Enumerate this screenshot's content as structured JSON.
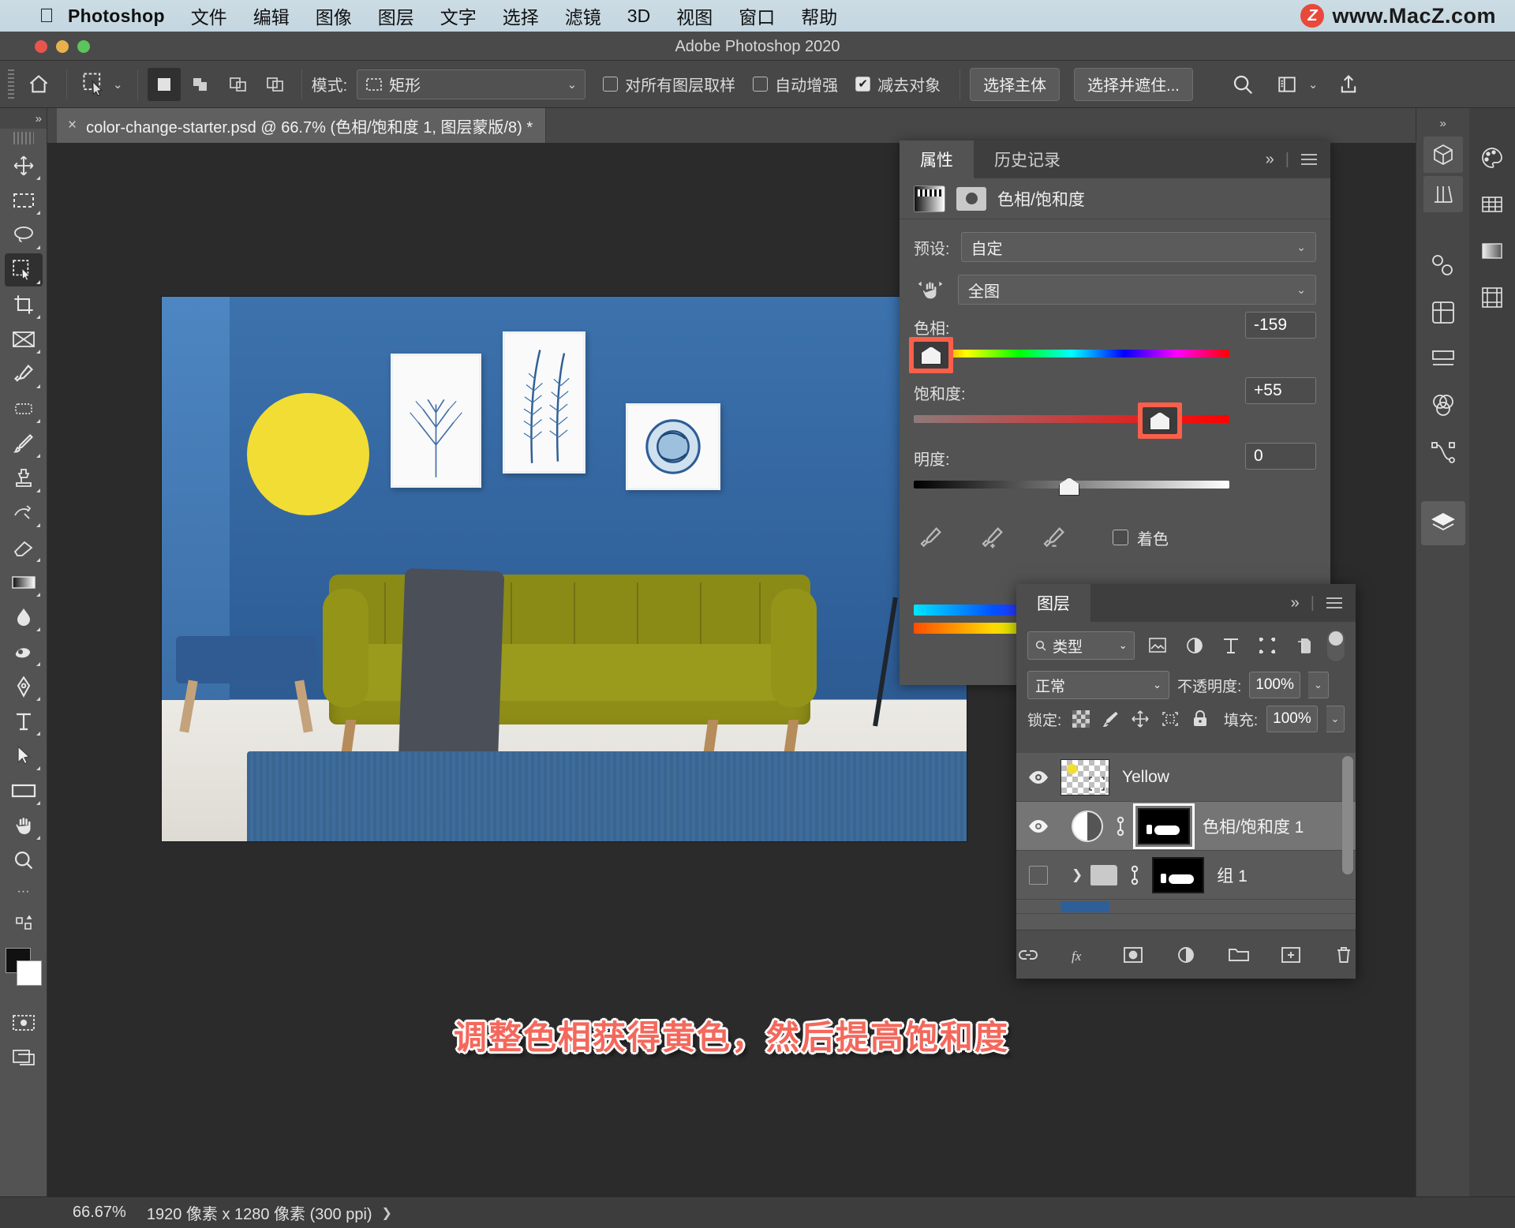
{
  "menubar": {
    "apple_icon": "apple-icon",
    "app_name": "Photoshop",
    "items": [
      "文件",
      "编辑",
      "图像",
      "图层",
      "文字",
      "选择",
      "滤镜",
      "3D",
      "视图",
      "窗口",
      "帮助"
    ],
    "watermark_badge": "Z",
    "watermark_text": "www.MacZ.com"
  },
  "window": {
    "title": "Adobe Photoshop 2020"
  },
  "options_bar": {
    "home_icon": "home-icon",
    "tool_icon": "quick-selection-tool-icon",
    "tool_caret": "⌄",
    "selection_modes": [
      "new-selection-icon",
      "add-to-selection-icon",
      "subtract-from-selection-icon",
      "intersect-selection-icon"
    ],
    "mode_label": "模式:",
    "mode_value": "矩形",
    "mode_caret": "⌄",
    "sample_all_layers": {
      "label": "对所有图层取样",
      "checked": false
    },
    "auto_enhance": {
      "label": "自动增强",
      "checked": false
    },
    "subtract_object": {
      "label": "减去对象",
      "checked": true
    },
    "select_subject": "选择主体",
    "select_and_mask": "选择并遮住...",
    "search_icon": "search-icon",
    "panel_icon": "workspace-icon",
    "panel_caret": "⌄",
    "share_icon": "share-icon"
  },
  "toolbar": {
    "collapse": "»",
    "tools": [
      "move-tool-icon",
      "rectangular-marquee-tool-icon",
      "lasso-tool-icon",
      "quick-selection-tool-icon",
      "crop-tool-icon",
      "frame-tool-icon",
      "eyedropper-tool-icon",
      "healing-brush-tool-icon",
      "brush-tool-icon",
      "clone-stamp-tool-icon",
      "history-brush-tool-icon",
      "eraser-tool-icon",
      "gradient-tool-icon",
      "blur-tool-icon",
      "dodge-tool-icon",
      "pen-tool-icon",
      "type-tool-icon",
      "path-selection-tool-icon",
      "rectangle-tool-icon",
      "hand-tool-icon",
      "zoom-tool-icon"
    ],
    "more_tools": "···",
    "edit_toolbar_icon": "edit-toolbar-icon",
    "quickmask_icon": "quick-mask-icon",
    "screenmode_icon": "screen-mode-icon"
  },
  "document": {
    "tab_close": "×",
    "tab_title": "color-change-starter.psd @ 66.7% (色相/饱和度 1, 图层蒙版/8) *",
    "caption": "调整色相获得黄色，然后提高饱和度",
    "caption_color": "#f4685c"
  },
  "properties": {
    "tabs": [
      {
        "label": "属性",
        "active": true
      },
      {
        "label": "历史记录",
        "active": false
      }
    ],
    "collapse_icon": "»",
    "menu_icon": "panel-menu-icon",
    "adjustment_icon": "hue-saturation-adjustment-icon",
    "mask_icon": "layer-mask-icon",
    "adjustment_name": "色相/饱和度",
    "preset_label": "预设:",
    "preset_value": "自定",
    "hand_icon": "on-image-adjustment-icon",
    "range_value": "全图",
    "hue": {
      "label": "色相:",
      "value": "-159",
      "knob_pct": 3,
      "highlighted": true
    },
    "saturation": {
      "label": "饱和度:",
      "value": "+55",
      "knob_pct": 77,
      "highlighted": true
    },
    "lightness": {
      "label": "明度:",
      "value": "0",
      "knob_pct": 50,
      "highlighted": false
    },
    "highlight_color": "#fb5f4a",
    "eyedroppers": [
      "eyedropper-icon",
      "eyedropper-add-icon",
      "eyedropper-subtract-icon"
    ],
    "colorize": {
      "label": "着色",
      "checked": false
    }
  },
  "layers": {
    "tab_label": "图层",
    "collapse_icon": "»",
    "menu_icon": "panel-menu-icon",
    "filter": {
      "search_icon": "search-icon",
      "value": "类型",
      "caret": "⌄"
    },
    "filter_icons": [
      "pixel-layer-filter-icon",
      "adjustment-layer-filter-icon",
      "type-layer-filter-icon",
      "shape-layer-filter-icon",
      "smart-object-filter-icon"
    ],
    "filter_toggle": "filter-toggle-icon",
    "blend_mode": "正常",
    "opacity_label": "不透明度:",
    "opacity_value": "100%",
    "lock_label": "锁定:",
    "lock_icons": [
      "lock-transparent-pixels-icon",
      "lock-image-pixels-icon",
      "lock-position-icon",
      "lock-artboard-icon",
      "lock-all-icon"
    ],
    "fill_label": "填充:",
    "fill_value": "100%",
    "rows": [
      {
        "name": "Yellow",
        "visible": true,
        "type": "pixel",
        "selected": false
      },
      {
        "name": "色相/饱和度 1",
        "visible": true,
        "type": "adjustment",
        "selected": true
      },
      {
        "name": "组 1",
        "visible": false,
        "type": "group",
        "selected": false
      }
    ],
    "bottom_icons": [
      "link-layers-icon",
      "layer-style-icon",
      "add-layer-mask-icon",
      "new-adjustment-layer-icon",
      "new-group-icon",
      "new-layer-icon",
      "delete-layer-icon"
    ]
  },
  "right_dock": {
    "collapse_icon": "»",
    "icons_primary": [
      "3d-panel-icon",
      "libraries-panel-icon"
    ],
    "icons_secondary": [
      "color-panel-icon",
      "swatches-panel-icon",
      "gradients-panel-icon",
      "patterns-panel-icon",
      "adjustments-panel-icon",
      "styles-panel-icon",
      "properties-panel-icon",
      "channels-panel-icon",
      "paths-panel-icon",
      "layers-panel-icon"
    ]
  },
  "status_bar": {
    "zoom": "66.67%",
    "dimensions": "1920 像素 x 1280 像素 (300 ppi)",
    "arrow": "❯"
  }
}
